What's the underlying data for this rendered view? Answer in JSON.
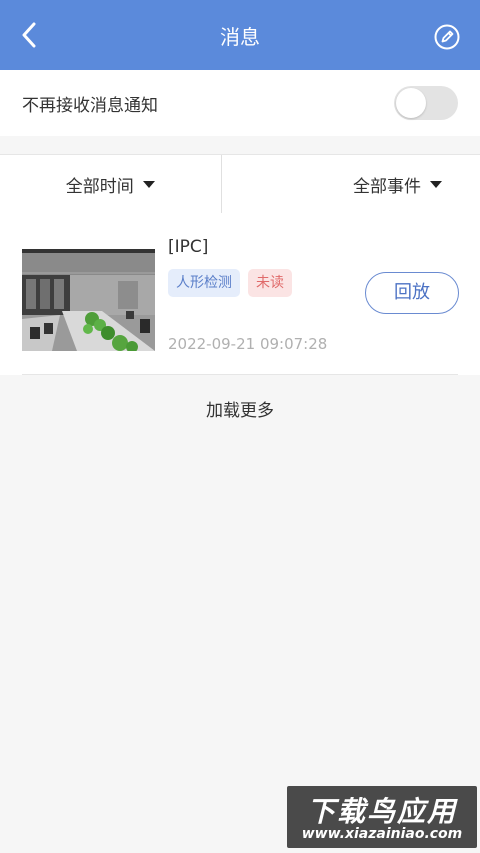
{
  "header": {
    "title": "消息",
    "bg_color": "#5b8adb",
    "back_icon": "chevron-left-icon",
    "edit_icon": "edit-pencil-icon"
  },
  "notification_toggle": {
    "label": "不再接收消息通知",
    "enabled": false
  },
  "filters": {
    "time": "全部时间",
    "event": "全部事件"
  },
  "messages": [
    {
      "camera": "[IPC]",
      "event_tag": "人形检测",
      "status_tag": "未读",
      "replay_label": "回放",
      "timestamp": "2022-09-21 09:07:28"
    }
  ],
  "load_more": "加载更多",
  "watermark": {
    "title": "下载鸟应用",
    "url": "www.xiazainiao.com"
  }
}
